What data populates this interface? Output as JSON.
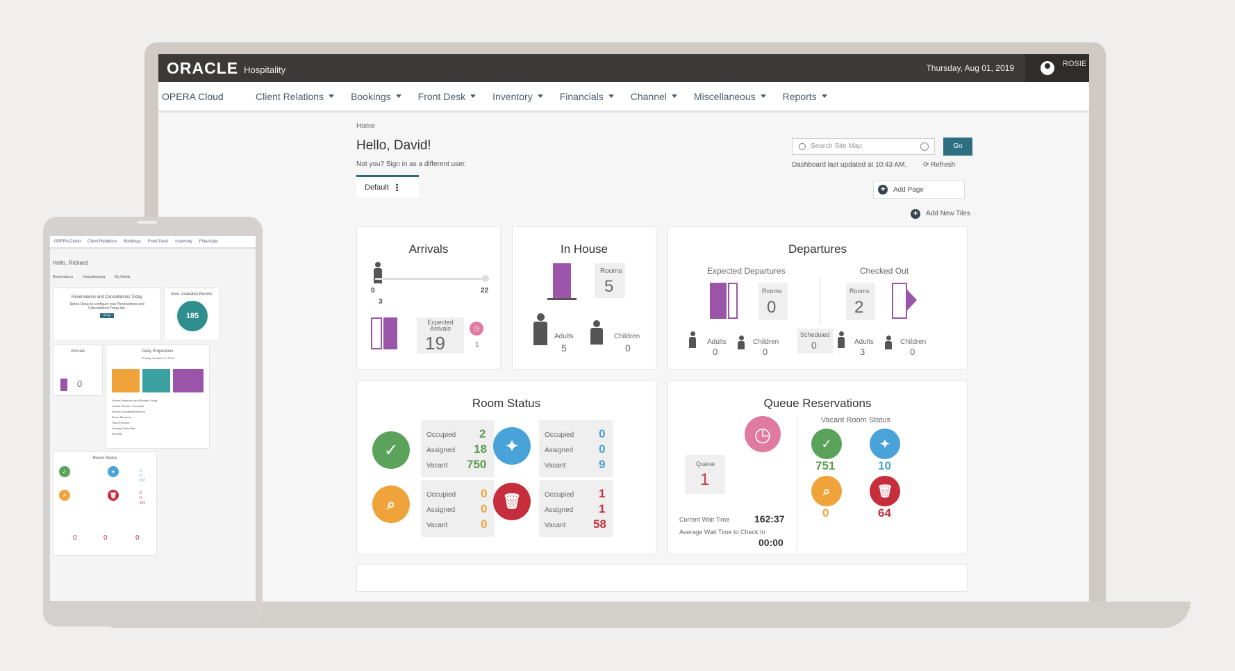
{
  "topbar": {
    "logo": "ORACLE",
    "product": "Hospitality",
    "date": "Thursday, Aug 01, 2019",
    "user": "ROSIE"
  },
  "nav": {
    "brand": "OPERA Cloud",
    "items": [
      "Client Relations",
      "Bookings",
      "Front Desk",
      "Inventory",
      "Financials",
      "Channel",
      "Miscellaneous",
      "Reports"
    ]
  },
  "page": {
    "breadcrumb": "Home",
    "greeting": "Hello, David!",
    "not_you": "Not you? Sign in as a different user.",
    "tab": "Default",
    "search_placeholder": "Search Site Map",
    "go": "Go",
    "updated": "Dashboard last updated at 10:43 AM.",
    "refresh": "Refresh",
    "add_page": "Add Page",
    "add_tiles": "Add New Tiles"
  },
  "arrivals": {
    "title": "Arrivals",
    "slider_min": "0",
    "slider_max": "22",
    "slider_value": "3",
    "expected_label": "Expected Arrivals",
    "expected_value": "19",
    "clock_count": "1"
  },
  "inhouse": {
    "title": "In House",
    "rooms_label": "Rooms",
    "rooms": "5",
    "adults_label": "Adults",
    "adults": "5",
    "children_label": "Children",
    "children": "0"
  },
  "departures": {
    "title": "Departures",
    "expected_label": "Expected Departures",
    "checked_label": "Checked Out",
    "rooms_label": "Rooms",
    "expected_rooms": "0",
    "checked_rooms": "2",
    "scheduled_label": "Scheduled",
    "scheduled": "0",
    "adults_label": "Adults",
    "children_label": "Children",
    "exp_adults": "0",
    "exp_children": "0",
    "out_adults": "3",
    "out_children": "0"
  },
  "room_status": {
    "title": "Room Status",
    "labels": [
      "Occupied",
      "Assigned",
      "Vacant"
    ],
    "clean": [
      "2",
      "18",
      "750"
    ],
    "inspected": [
      "0",
      "0",
      "9"
    ],
    "pickup": [
      "0",
      "0",
      "0"
    ],
    "dirty": [
      "1",
      "1",
      "58"
    ]
  },
  "queue": {
    "title": "Queue Reservations",
    "vacant_label": "Vacant Room Status",
    "queue_label": "Queue",
    "queue": "1",
    "wait_label": "Current Wait Time",
    "wait": "162:37",
    "avg_label": "Average Wait Time to Check In",
    "avg": "00:00",
    "vacant_clean": "751",
    "vacant_inspected": "10",
    "vacant_pickup": "0",
    "vacant_dirty": "64"
  },
  "tablet": {
    "greeting": "Hello, Richard",
    "brand": "OPERA Cloud",
    "nav": [
      "Client Relations",
      "Bookings",
      "Front Desk",
      "Inventory",
      "Financials"
    ],
    "tabs": [
      "Reservations",
      "Housekeeping",
      "My Hotels"
    ],
    "res_title": "Reservations and Cancellations Today",
    "res_text": "Select Setup to configure your Reservations and Cancellations Today tile.",
    "res_button": "Setup",
    "max_title": "Max. Available Rooms",
    "max_value": "185",
    "arrivals_title": "Arrivals",
    "arrivals_value": "0",
    "proj_title": "Daily Projections",
    "proj_date": "Sunday, October 27, 2019",
    "proj_rows": [
      "Rooms Reserved and Blocked Today",
      "Vacant Rooms / Occupied",
      "Rooms in Available Rooms",
      "Room Revenue",
      "Total Revenue",
      "Average Daily Rate",
      "RevPAR"
    ],
    "room_title": "Room Status",
    "room_vals": [
      "0",
      "0",
      "107",
      "0",
      "0",
      "161"
    ],
    "bottom_vals": [
      "0",
      "0",
      "0"
    ]
  },
  "colors": {
    "accent": "#2d6e80",
    "purple": "#9a55a9",
    "green": "#5ba35a",
    "blue": "#4aa3d8",
    "orange": "#f0a33a",
    "red": "#c72e3c"
  }
}
